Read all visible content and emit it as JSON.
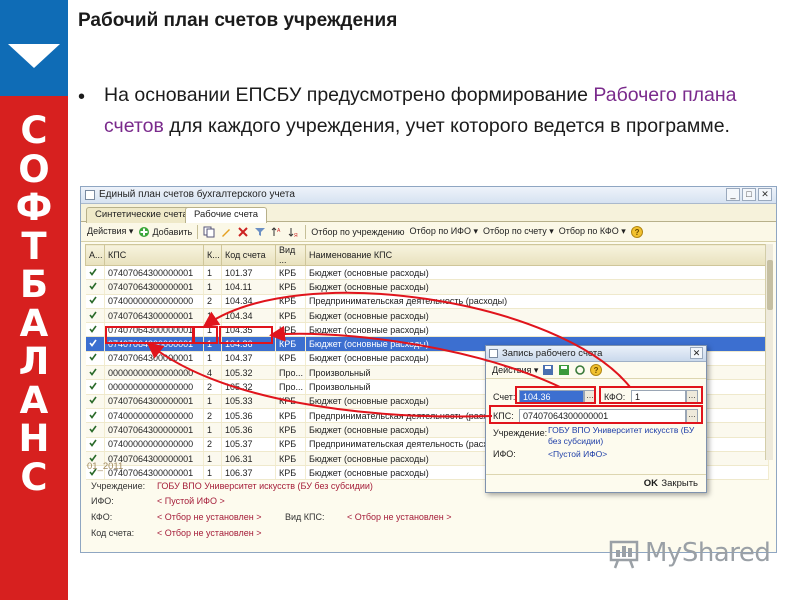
{
  "brand": {
    "letters": [
      "С",
      "О",
      "Ф",
      "Т",
      "Б",
      "А",
      "Л",
      "А",
      "Н",
      "С"
    ],
    "name": "СОФТБАЛАНС"
  },
  "slide": {
    "title": "Рабочий план счетов учреждения",
    "bullet_pre": "На основании ЕПСБУ предусмотрено формирование ",
    "bullet_highlight": "Рабочего плана счетов",
    "bullet_post": " для каждого учреждения, учет которого ведется в программе."
  },
  "window": {
    "title": "Единый план счетов бухгалтерского учета",
    "tabs": [
      "Синтетические счета",
      "Рабочие счета"
    ],
    "active_tab": 1,
    "toolbar": {
      "actions": "Действия ▾",
      "add": "Добавить",
      "filter_institution": "Отбор по учреждению",
      "filter_ifo": "Отбор по ИФО ▾",
      "filter_account": "Отбор по счету ▾",
      "filter_kfo": "Отбор по КФО ▾"
    },
    "columns": [
      "А...",
      "КПС",
      "К...",
      "Код счета",
      "Вид ...",
      "Наименование КПС"
    ],
    "rows": [
      [
        "07407064300000001",
        "1",
        "101.37",
        "КРБ",
        "Бюджет (основные расходы)"
      ],
      [
        "07407064300000001",
        "1",
        "104.11",
        "КРБ",
        "Бюджет (основные расходы)"
      ],
      [
        "07400000000000000",
        "2",
        "104.34",
        "КРБ",
        "Предпринимательская деятельность (расходы)"
      ],
      [
        "07407064300000001",
        "1",
        "104.34",
        "КРБ",
        "Бюджет (основные расходы)"
      ],
      [
        "07407064300000001",
        "1",
        "104.35",
        "КРБ",
        "Бюджет (основные расходы)"
      ],
      [
        "07407064300000001",
        "1",
        "104.36",
        "КРБ",
        "Бюджет (основные расходы)"
      ],
      [
        "07407064300000001",
        "1",
        "104.37",
        "КРБ",
        "Бюджет (основные расходы)"
      ],
      [
        "00000000000000000",
        "4",
        "105.32",
        "Про...",
        "Произвольный"
      ],
      [
        "00000000000000000",
        "2",
        "105.32",
        "Про...",
        "Произвольный"
      ],
      [
        "07407064300000001",
        "1",
        "105.33",
        "КРБ",
        "Бюджет (основные расходы)"
      ],
      [
        "07400000000000000",
        "2",
        "105.36",
        "КРБ",
        "Предпринимательская деятельность (расходы)"
      ],
      [
        "07407064300000001",
        "1",
        "105.36",
        "КРБ",
        "Бюджет (основные расходы)"
      ],
      [
        "07400000000000000",
        "2",
        "105.37",
        "КРБ",
        "Предпринимательская деятельность (расходы)"
      ],
      [
        "07407064300000001",
        "1",
        "106.31",
        "КРБ",
        "Бюджет (основные расходы)"
      ],
      [
        "07407064300000001",
        "1",
        "106.37",
        "КРБ",
        "Бюджет (основные расходы)"
      ]
    ],
    "selected_row": 5,
    "panel": {
      "period": "01_2011",
      "institution_label": "Учреждение:",
      "institution_value": "ГОБУ ВПО Университет искусств (БУ без субсидии)",
      "ifo_label": "ИФО:",
      "ifo_value": "< Пустой ИФО >",
      "kfo_label": "КФО:",
      "kfo_value": "< Отбор не установлен >",
      "vid_kps_label": "Вид КПС:",
      "vid_kps_value": "< Отбор не установлен >",
      "account_label": "Код счета:",
      "account_value": "< Отбор не установлен >"
    }
  },
  "dialog": {
    "title": "Запись рабочего счета",
    "actions": "Действия ▾",
    "account_label": "Счет:",
    "account_value": "104.36",
    "kfo_label": "КФО:",
    "kfo_value": "1",
    "kps_label": "КПС:",
    "kps_value": "07407064300000001",
    "institution_label": "Учреждение:",
    "institution_value": "ГОБУ ВПО Университет искусств (БУ без субсидии)",
    "ifo_label": "ИФО:",
    "ifo_value": "<Пустой ИФО>",
    "ok": "OK",
    "close": "Закрыть"
  },
  "watermark": {
    "text": "MyShared"
  },
  "colors": {
    "brand_red": "#d7201f",
    "brand_blue": "#0f6cb6",
    "selection": "#3c6fd0",
    "annotation": "#e0141c",
    "highlight_text": "#7a2a8c"
  }
}
